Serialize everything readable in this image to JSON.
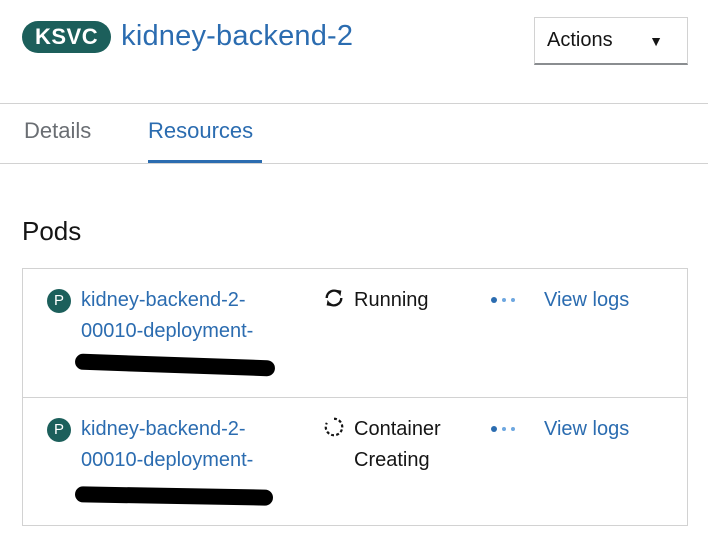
{
  "header": {
    "badge": "KSVC",
    "title": "kidney-backend-2",
    "actions_label": "Actions"
  },
  "tabs": [
    {
      "label": "Details",
      "active": false
    },
    {
      "label": "Resources",
      "active": true
    }
  ],
  "section_title": "Pods",
  "pods": [
    {
      "icon_letter": "P",
      "name_line1": "kidney-backend-2-",
      "name_line2": "00010-deployment-",
      "status_icon": "sync-icon",
      "status_line1": "Running",
      "status_line2": "",
      "logs_label": "View logs"
    },
    {
      "icon_letter": "P",
      "name_line1": "kidney-backend-2-",
      "name_line2": "00010-deployment-",
      "status_icon": "in-progress-icon",
      "status_line1": "Container",
      "status_line2": "Creating",
      "logs_label": "View logs"
    }
  ],
  "colors": {
    "accent": "#2b6cb0",
    "badge": "#1c5f5b",
    "border": "#d2d2d2"
  }
}
